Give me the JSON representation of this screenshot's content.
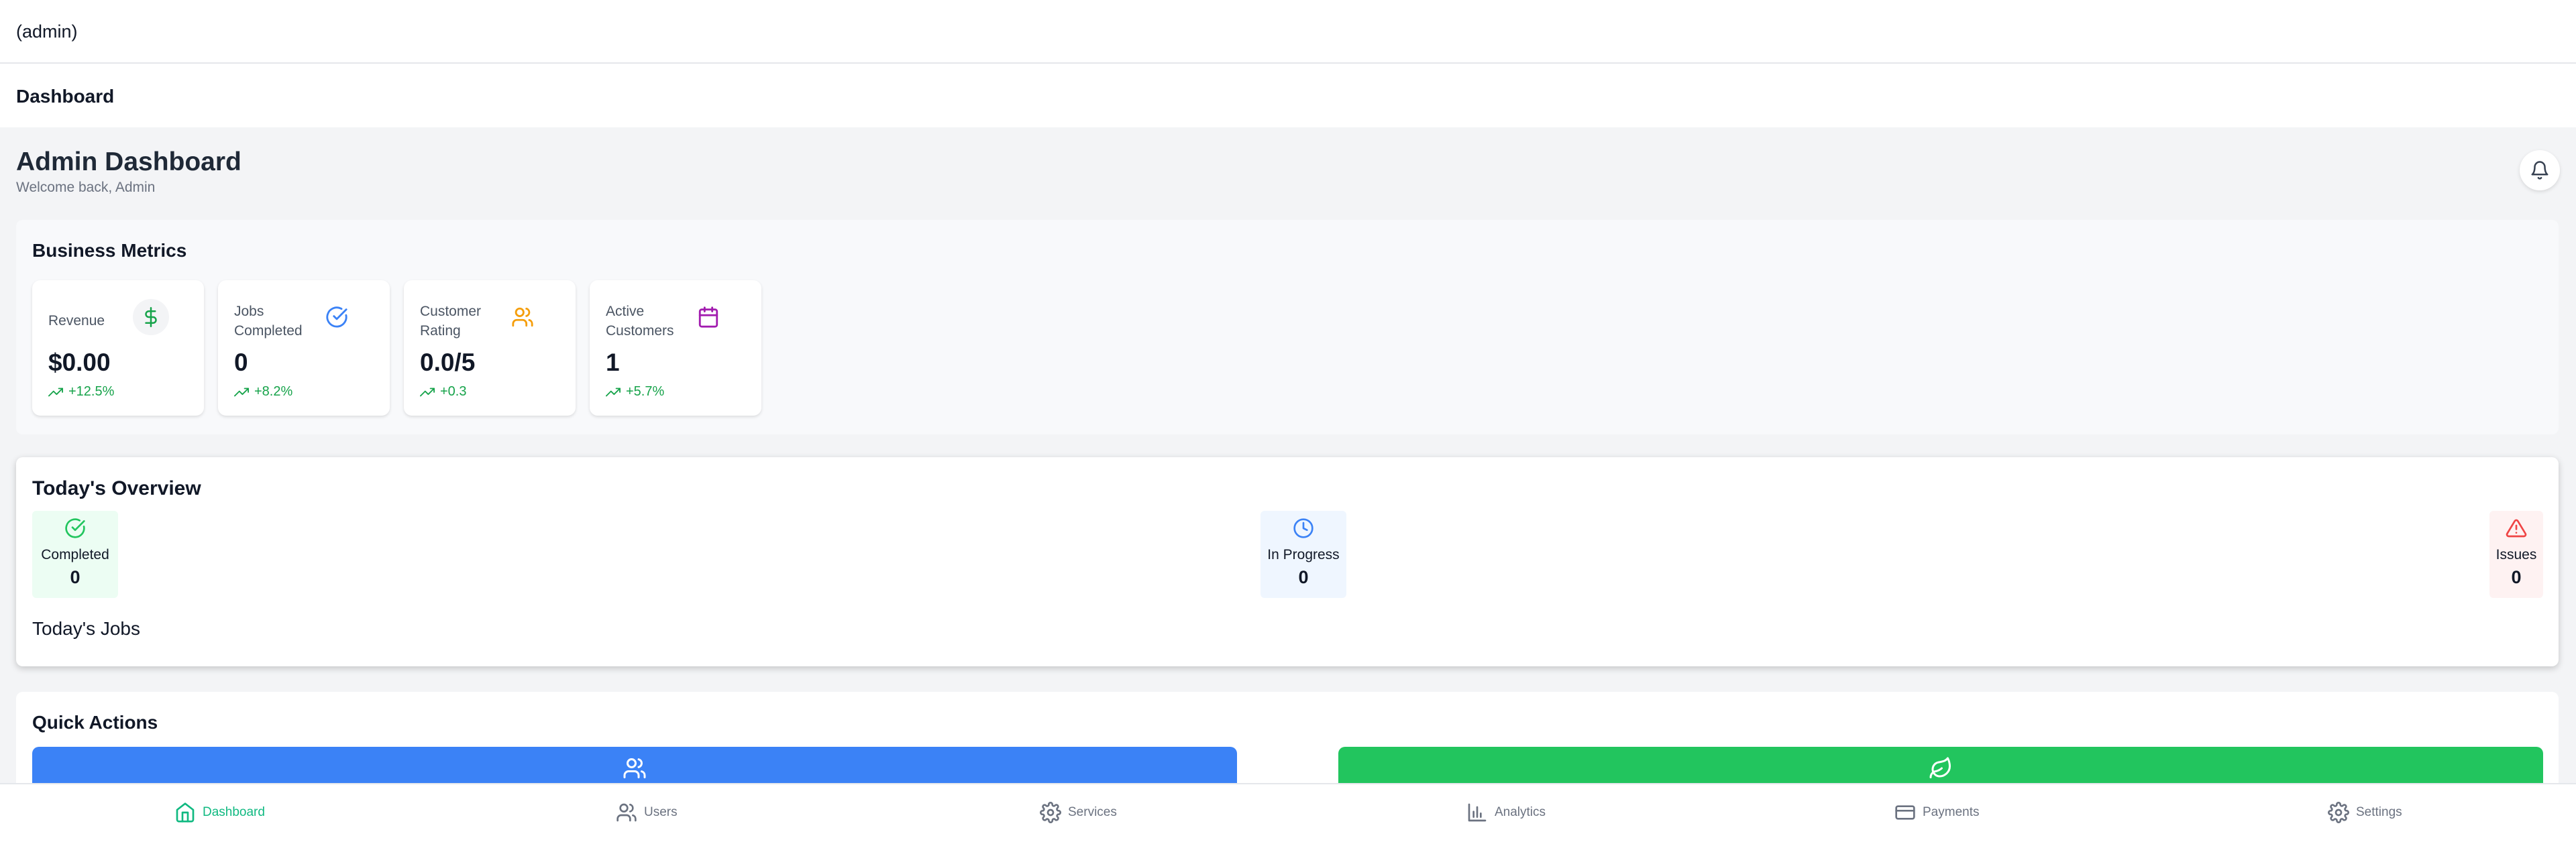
{
  "topbar": {
    "role": "(admin)"
  },
  "header": {
    "title": "Dashboard"
  },
  "page": {
    "title": "Admin Dashboard",
    "subtitle": "Welcome back, Admin"
  },
  "metrics": {
    "title": "Business Metrics",
    "cards": [
      {
        "label": "Revenue",
        "value": "$0.00",
        "trend": "+12.5%",
        "icon": "dollar-icon",
        "color": "#16a34a"
      },
      {
        "label": "Jobs Completed",
        "value": "0",
        "trend": "+8.2%",
        "icon": "check-circle-icon",
        "color": "#3b82f6"
      },
      {
        "label": "Customer Rating",
        "value": "0.0/5",
        "trend": "+0.3",
        "icon": "users-icon",
        "color": "#f59e0b"
      },
      {
        "label": "Active Customers",
        "value": "1",
        "trend": "+5.7%",
        "icon": "calendar-icon",
        "color": "#a21caf"
      }
    ]
  },
  "overview": {
    "title": "Today's Overview",
    "tiles": [
      {
        "label": "Completed",
        "value": "0",
        "icon": "check-circle-icon",
        "bg": "#ecfdf3",
        "color": "#22c55e"
      },
      {
        "label": "In Progress",
        "value": "0",
        "icon": "clock-icon",
        "bg": "#eff6ff",
        "color": "#3b82f6"
      },
      {
        "label": "Issues",
        "value": "0",
        "icon": "alert-triangle-icon",
        "bg": "#fef2f2",
        "color": "#ef4444"
      }
    ],
    "jobs_title": "Today's Jobs"
  },
  "quick_actions": {
    "title": "Quick Actions",
    "buttons": [
      {
        "icon": "users-icon",
        "color": "#3b82f6"
      },
      {
        "icon": "leaf-icon",
        "color": "#22c55e"
      }
    ]
  },
  "nav": {
    "active_color": "#10b981",
    "items": [
      {
        "label": "Dashboard",
        "icon": "home-icon",
        "active": true
      },
      {
        "label": "Users",
        "icon": "users-icon"
      },
      {
        "label": "Services",
        "icon": "gear-icon"
      },
      {
        "label": "Analytics",
        "icon": "bar-chart-icon"
      },
      {
        "label": "Payments",
        "icon": "credit-card-icon"
      },
      {
        "label": "Settings",
        "icon": "gear-icon"
      }
    ]
  }
}
